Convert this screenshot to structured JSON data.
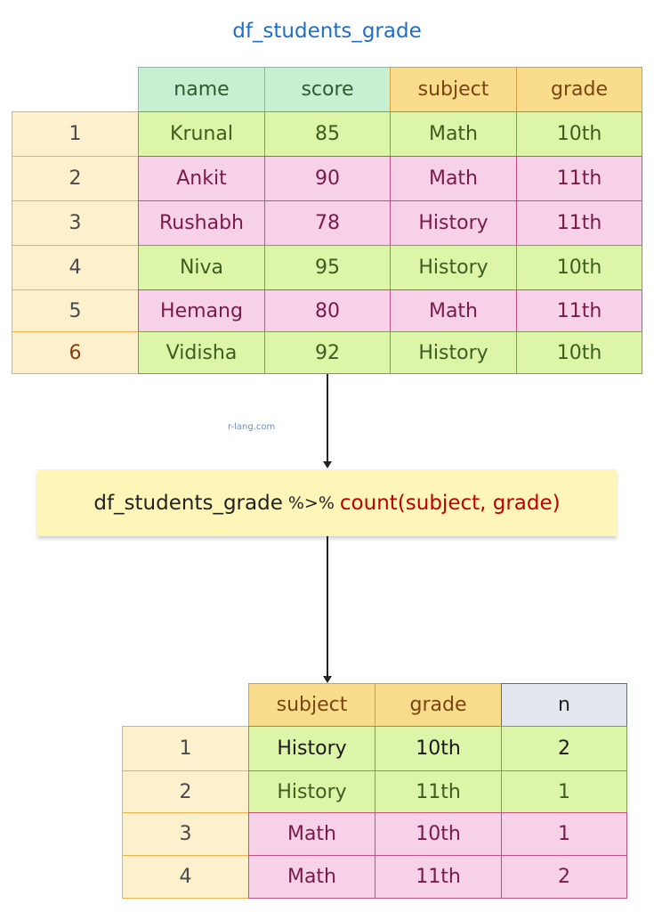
{
  "title": "df_students_grade",
  "watermark": "r-lang.com",
  "input_table": {
    "columns": [
      "name",
      "score",
      "subject",
      "grade"
    ],
    "rows": [
      {
        "index": "1",
        "name": "Krunal",
        "score": "85",
        "subject": "Math",
        "grade": "10th"
      },
      {
        "index": "2",
        "name": "Ankit",
        "score": "90",
        "subject": "Math",
        "grade": "11th"
      },
      {
        "index": "3",
        "name": "Rushabh",
        "score": "78",
        "subject": "History",
        "grade": "11th"
      },
      {
        "index": "4",
        "name": "Niva",
        "score": "95",
        "subject": "History",
        "grade": "10th"
      },
      {
        "index": "5",
        "name": "Hemang",
        "score": "80",
        "subject": "Math",
        "grade": "11th"
      },
      {
        "index": "6",
        "name": "Vidisha",
        "score": "92",
        "subject": "History",
        "grade": "10th"
      }
    ]
  },
  "code": {
    "object": "df_students_grade",
    "pipe": "%>%",
    "call": "count(subject, grade)"
  },
  "output_table": {
    "columns": [
      "subject",
      "grade",
      "n"
    ],
    "rows": [
      {
        "index": "1",
        "subject": "History",
        "grade": "10th",
        "n": "2"
      },
      {
        "index": "2",
        "subject": "History",
        "grade": "11th",
        "n": "1"
      },
      {
        "index": "3",
        "subject": "Math",
        "grade": "10th",
        "n": "1"
      },
      {
        "index": "4",
        "subject": "Math",
        "grade": "11th",
        "n": "2"
      }
    ]
  },
  "colors": {
    "title": "#1f6fc0",
    "function_call": "#c00000",
    "green_row": "#dcf5a8",
    "pink_row": "#f6d1e8",
    "index_col": "#fdf0cc"
  }
}
